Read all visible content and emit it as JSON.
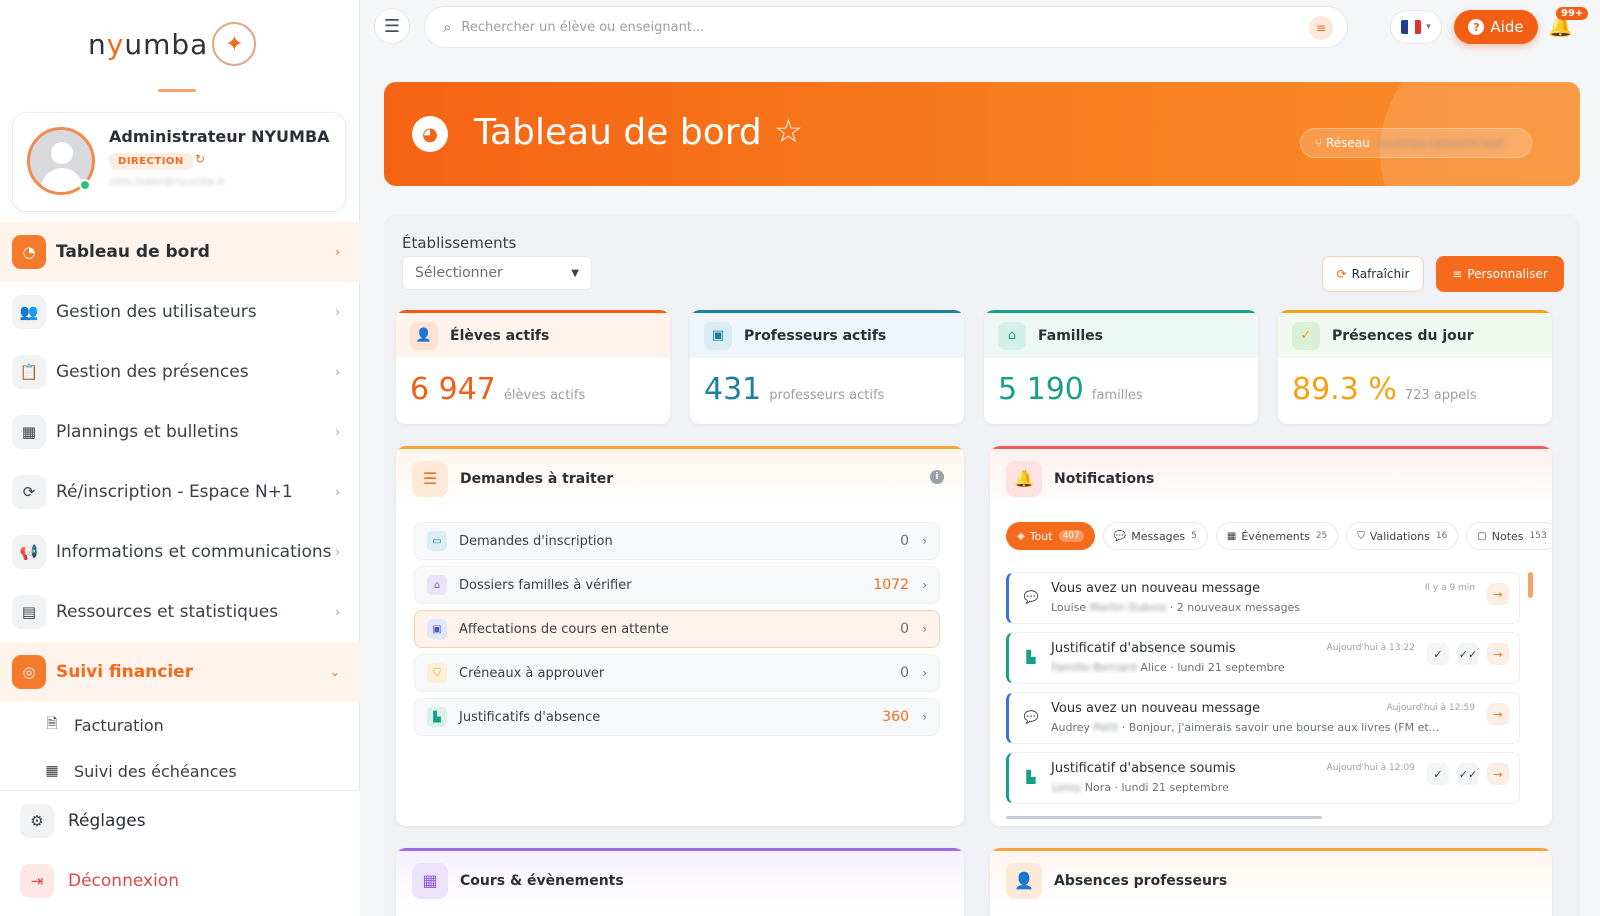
{
  "brand": {
    "logo_text_1": "n",
    "logo_text_y": "y",
    "logo_text_2": "umba",
    "logo_icon": "sparkle-icon"
  },
  "profile": {
    "name": "Administrateur NYUMBA",
    "role": "DIRECTION",
    "email": "nikki.baker@nyumba.fr"
  },
  "sidebar": {
    "items": [
      {
        "label": "Tableau de bord",
        "icon": "dashboard-icon"
      },
      {
        "label": "Gestion des utilisateurs",
        "icon": "users-icon"
      },
      {
        "label": "Gestion des présences",
        "icon": "clipboard-icon"
      },
      {
        "label": "Plannings et bulletins",
        "icon": "calendar-icon"
      },
      {
        "label": "Ré/inscription - Espace N+1",
        "icon": "refresh-icon"
      },
      {
        "label": "Informations et communications",
        "icon": "megaphone-icon"
      },
      {
        "label": "Ressources et statistiques",
        "icon": "archive-icon"
      },
      {
        "label": "Suivi financier",
        "icon": "coins-icon"
      }
    ],
    "sub_items": [
      {
        "label": "Facturation",
        "icon": "invoice-icon"
      },
      {
        "label": "Suivi des échéances",
        "icon": "calendar-check-icon"
      }
    ],
    "settings": "Réglages",
    "logout": "Déconnexion"
  },
  "topbar": {
    "search_placeholder": "Rechercher un élève ou enseignant...",
    "help": "Aide",
    "notif_badge": "99+"
  },
  "banner": {
    "title": "Tableau de bord",
    "network_label": "Réseau",
    "network_value": "nyumba.network.test"
  },
  "filters": {
    "label": "Établissements",
    "select_placeholder": "Sélectionner",
    "refresh": "Rafraîchir",
    "customize": "Personnaliser"
  },
  "kpis": [
    {
      "title": "Élèves actifs",
      "value": "6 947",
      "sub": "élèves actifs",
      "color": "#f25f14",
      "bg": "#fff3ec",
      "ico_bg": "#fde2d3"
    },
    {
      "title": "Professeurs actifs",
      "value": "431",
      "sub": "professeurs actifs",
      "color": "#1f7f9e",
      "bg": "#eef6f9",
      "ico_bg": "#d8ecf3"
    },
    {
      "title": "Familles",
      "value": "5 190",
      "sub": "familles",
      "color": "#1aa088",
      "bg": "#edf8f5",
      "ico_bg": "#d3efe8"
    },
    {
      "title": "Présences du jour",
      "value": "89.3 %",
      "sub": "723 appels",
      "color": "#f5a112",
      "bg": "#f0f8ef",
      "ico_bg": "#d9f0d6"
    }
  ],
  "requests": {
    "title": "Demandes à traiter",
    "items": [
      {
        "label": "Demandes d'inscription",
        "count": "0"
      },
      {
        "label": "Dossiers familles à vérifier",
        "count": "1072"
      },
      {
        "label": "Affectations de cours en attente",
        "count": "0"
      },
      {
        "label": "Créneaux à approuver",
        "count": "0"
      },
      {
        "label": "Justificatifs d'absence",
        "count": "360"
      }
    ]
  },
  "notifications": {
    "title": "Notifications",
    "tabs": [
      {
        "label": "Tout",
        "count": "407"
      },
      {
        "label": "Messages",
        "count": "5"
      },
      {
        "label": "Événements",
        "count": "25"
      },
      {
        "label": "Validations",
        "count": "16"
      },
      {
        "label": "Notes",
        "count": "153"
      }
    ],
    "items": [
      {
        "title": "Vous avez un nouveau message",
        "who": "Louise",
        "blur": "Martin Dubois",
        "rest": " · 2 nouveaux messages",
        "time": "Il y a 9 min"
      },
      {
        "title": "Justificatif d'absence soumis",
        "who": "Alice · lundi 21 septembre",
        "blur": "Famille Bernard",
        "rest": "",
        "time": "Aujourd'hui à 13:22"
      },
      {
        "title": "Vous avez un nouveau message",
        "who": "Audrey",
        "blur": "Petit",
        "rest": " · Bonjour, j'aimerais savoir une bourse aux livres (FM et...",
        "time": "Aujourd'hui à 12:59"
      },
      {
        "title": "Justificatif d'absence soumis",
        "who": "Nora · lundi 21 septembre",
        "blur": "Leroy",
        "rest": "",
        "time": "Aujourd'hui à 12:09"
      }
    ]
  },
  "bottom_panels": {
    "courses": "Cours & évènements",
    "absences": "Absences professeurs"
  }
}
